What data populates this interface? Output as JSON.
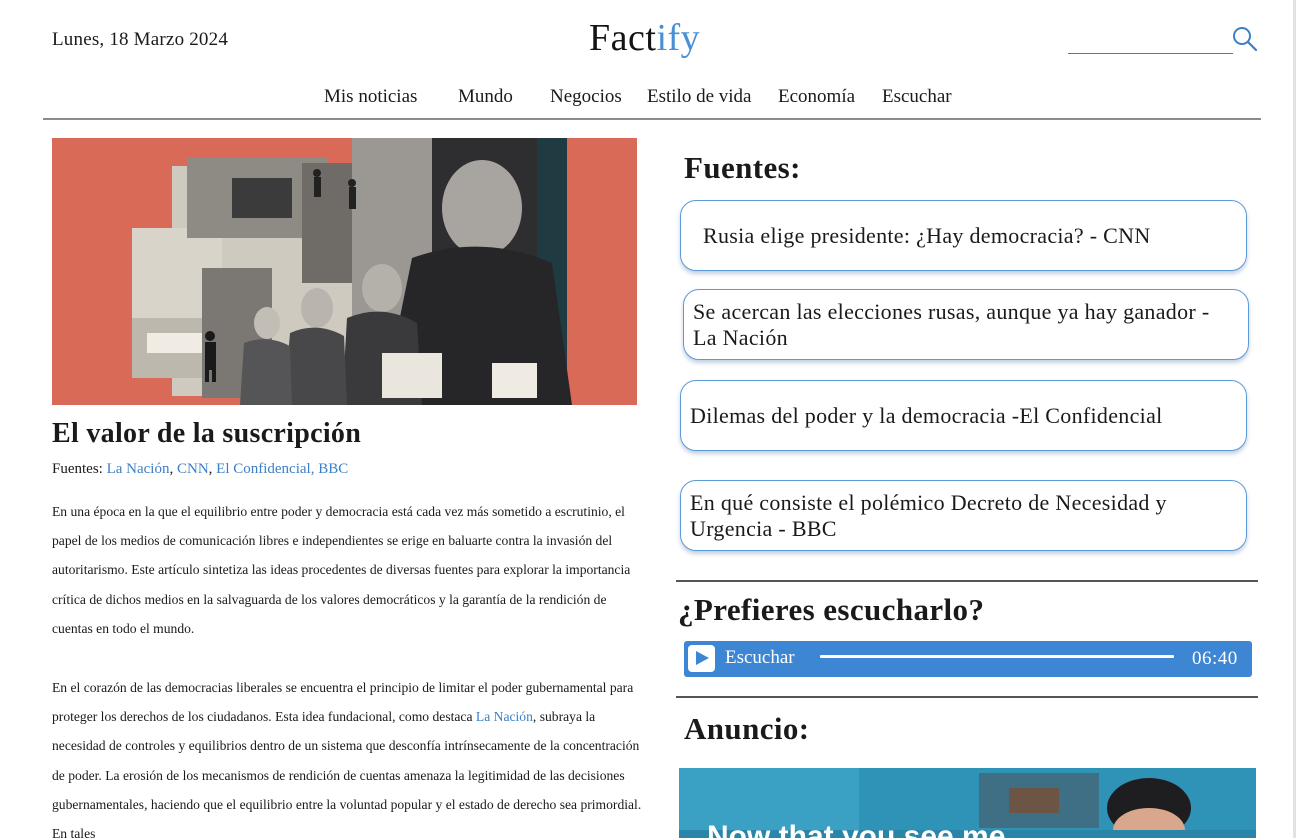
{
  "header": {
    "date": "Lunes, 18 Marzo 2024",
    "logo_main": "Fact",
    "logo_accent": "ify",
    "search_placeholder": "",
    "search_icon": "search-icon"
  },
  "nav": {
    "items": [
      {
        "label": "Mis noticias"
      },
      {
        "label": "Mundo"
      },
      {
        "label": "Negocios"
      },
      {
        "label": "Estilo de vida"
      },
      {
        "label": "Economía"
      },
      {
        "label": "Escuchar"
      }
    ]
  },
  "article": {
    "title": "El valor de la suscripción",
    "sources_prefix": "Fuentes:",
    "sources": [
      "La Nación",
      "CNN",
      "El Confidencial",
      "BBC"
    ],
    "p1": "En una época en la que el equilibrio entre poder y democracia está cada vez más sometido a escrutinio, el papel de los medios de comunicación libres e independientes se erige en baluarte contra la invasión del autoritarismo. Este artículo sintetiza las ideas procedentes de diversas fuentes para explorar la importancia crítica de dichos medios en la salvaguarda de los valores democráticos y la garantía de la rendición de cuentas en todo el mundo.",
    "p2_before": "En el corazón de las democracias liberales se encuentra el principio de limitar el poder gubernamental para proteger los derechos de los ciudadanos. Esta idea fundacional, como destaca ",
    "p2_link": "La Nación",
    "p2_after": ", subraya la necesidad de controles y equilibrios dentro de un sistema que desconfía intrínsecamente de la concentración de poder. La erosión de los mecanismos de rendición de cuentas amenaza la legitimidad de las decisiones gubernamentales, haciendo que el equilibrio entre la voluntad popular y el estado de derecho sea primordial. En tales"
  },
  "sidebar": {
    "sources_heading": "Fuentes:",
    "source_cards": [
      {
        "text": "Rusia elige presidente: ¿Hay democracia? - CNN"
      },
      {
        "text": "Se acercan las elecciones rusas, aunque ya hay ganador - La Nación"
      },
      {
        "text": "Dilemas del poder y la democracia -El Confidencial"
      },
      {
        "text": "En qué consiste el polémico Decreto de Necesidad y Urgencia  - BBC"
      }
    ],
    "listen_heading": "¿Prefieres escucharlo?",
    "player": {
      "label": "Escuchar",
      "duration": "06:40",
      "progress": 1.0,
      "play_icon": "play-icon"
    },
    "ad_heading": "Anuncio:",
    "ad_text": "Now that you see me"
  },
  "colors": {
    "accent": "#4a8fd6",
    "link": "#3d7fc6",
    "player_bg": "#3d86d3",
    "hero_bg": "#d86a57"
  }
}
